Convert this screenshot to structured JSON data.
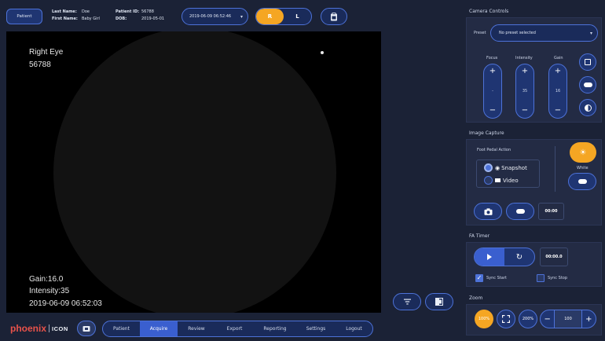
{
  "topbar": {
    "patient_button": "Patient",
    "last_name_label": "Last Name:",
    "last_name": "Doe",
    "first_name_label": "First Name:",
    "first_name": "Baby Girl",
    "patient_id_label": "Patient ID:",
    "patient_id": "56788",
    "dob_label": "DOB:",
    "dob": "2019-05-01",
    "session_select": "2019-06-09 06:52:46",
    "eye_right": "R",
    "eye_left": "L"
  },
  "viewer": {
    "eye_label": "Right Eye",
    "eye_id": "56788",
    "gain": "Gain:16.0",
    "intensity": "Intensity:35",
    "timestamp": "2019-06-09 06:52:03"
  },
  "bottom_nav": {
    "brand_phoenix": "phoenix",
    "brand_icon": "ICON",
    "items": [
      {
        "label": "Patient"
      },
      {
        "label": "Acquire"
      },
      {
        "label": "Review"
      },
      {
        "label": "Export"
      },
      {
        "label": "Reporting"
      },
      {
        "label": "Settings"
      },
      {
        "label": "Logout"
      }
    ],
    "active_index": 1
  },
  "camera_controls": {
    "title": "Camera Controls",
    "preset_label": "Preset",
    "preset_value": "No preset selected",
    "focus_label": "Focus",
    "focus_value": "-",
    "intensity_label": "Intensity",
    "intensity_value": "35",
    "gain_label": "Gain",
    "gain_value": "16"
  },
  "image_capture": {
    "title": "Image Capture",
    "foot_pedal_label": "Foot Pedal Action",
    "snapshot_label": "Snapshot",
    "video_label": "Video",
    "selected_mode": "Snapshot",
    "white_label": "White",
    "timer": "00:00"
  },
  "fa_timer": {
    "title": "FA Timer",
    "time": "00:00.0",
    "sync_start_label": "Sync Start",
    "sync_start_checked": true,
    "sync_stop_label": "Sync Stop",
    "sync_stop_checked": false
  },
  "zoom": {
    "title": "Zoom",
    "preset_100": "100%",
    "preset_200": "200%",
    "value": "100",
    "minus": "−",
    "plus": "+"
  },
  "colors": {
    "accent_orange": "#f5a623",
    "accent_blue": "#4d72d8",
    "background": "#1b2236"
  }
}
